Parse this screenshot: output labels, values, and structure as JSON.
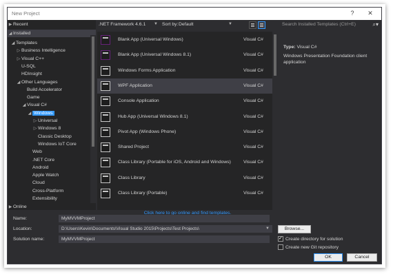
{
  "window": {
    "title": "New Project",
    "help_glyph": "?",
    "close_glyph": "✕"
  },
  "tree": {
    "recent": "Recent",
    "installed": "Installed",
    "items": [
      {
        "label": "Templates",
        "level": 1,
        "arrow": "◢"
      },
      {
        "label": "Business Intelligence",
        "level": 2,
        "arrow": "▷"
      },
      {
        "label": "Visual C++",
        "level": 2,
        "arrow": "▷"
      },
      {
        "label": "U-SQL",
        "level": 2,
        "arrow": ""
      },
      {
        "label": "HDInsight",
        "level": 2,
        "arrow": ""
      },
      {
        "label": "Other Languages",
        "level": 2,
        "arrow": "◢"
      },
      {
        "label": "Build Accelerator",
        "level": 3,
        "arrow": ""
      },
      {
        "label": "Game",
        "level": 3,
        "arrow": ""
      },
      {
        "label": "Visual C#",
        "level": 3,
        "arrow": "◢"
      },
      {
        "label": "Windows",
        "level": 4,
        "arrow": "◢"
      },
      {
        "label": "Universal",
        "level": 5,
        "arrow": "▷"
      },
      {
        "label": "Windows 8",
        "level": 5,
        "arrow": "▷"
      },
      {
        "label": "Classic Desktop",
        "level": 5,
        "arrow": ""
      },
      {
        "label": "Windows IoT Core",
        "level": 5,
        "arrow": ""
      },
      {
        "label": "Web",
        "level": 4,
        "arrow": ""
      },
      {
        "label": ".NET Core",
        "level": 4,
        "arrow": ""
      },
      {
        "label": "Android",
        "level": 4,
        "arrow": ""
      },
      {
        "label": "Apple Watch",
        "level": 4,
        "arrow": ""
      },
      {
        "label": "Cloud",
        "level": 4,
        "arrow": ""
      },
      {
        "label": "Cross-Platform",
        "level": 4,
        "arrow": ""
      },
      {
        "label": "Extensibility",
        "level": 4,
        "arrow": ""
      }
    ],
    "selected": "Windows",
    "online": "Online"
  },
  "toolbar": {
    "framework": ".NET Framework 4.6.1",
    "sort_label": "Sort by:",
    "sort_value": "Default"
  },
  "templates": [
    {
      "name": "Blank App (Universal Windows)",
      "lang": "Visual C#"
    },
    {
      "name": "Blank App (Universal Windows 8.1)",
      "lang": "Visual C#"
    },
    {
      "name": "Windows Forms Application",
      "lang": "Visual C#"
    },
    {
      "name": "WPF Application",
      "lang": "Visual C#"
    },
    {
      "name": "Console Application",
      "lang": "Visual C#"
    },
    {
      "name": "Hub App (Universal Windows 8.1)",
      "lang": "Visual C#"
    },
    {
      "name": "Pivot App (Windows Phone)",
      "lang": "Visual C#"
    },
    {
      "name": "Shared Project",
      "lang": "Visual C#"
    },
    {
      "name": "Class Library (Portable for iOS, Android and Windows)",
      "lang": "Visual C#"
    },
    {
      "name": "Class Library",
      "lang": "Visual C#"
    },
    {
      "name": "Class Library (Portable)",
      "lang": "Visual C#"
    }
  ],
  "selected_template": "WPF Application",
  "online_link": "Click here to go online and find templates.",
  "details": {
    "search_placeholder": "Search Installed Templates (Ctrl+E)",
    "type_label": "Type:",
    "type_value": "Visual C#",
    "description": "Windows Presentation Foundation client application"
  },
  "form": {
    "name_label": "Name:",
    "name_value": "MyMVVMProject",
    "location_label": "Location:",
    "location_value": "D:\\Users\\Kevin\\Documents\\Visual Studio 2015\\Projects\\Test Projects\\",
    "solution_label": "Solution name:",
    "solution_value": "MyMVVMProject",
    "browse": "Browse...",
    "create_dir": "Create directory for solution",
    "create_dir_checked": true,
    "create_git": "Create new Git repository",
    "create_git_checked": false,
    "ok": "OK",
    "cancel": "Cancel"
  },
  "colors": {
    "accent": "#3399ff",
    "background": "#2d2d30",
    "panel": "#252526"
  }
}
